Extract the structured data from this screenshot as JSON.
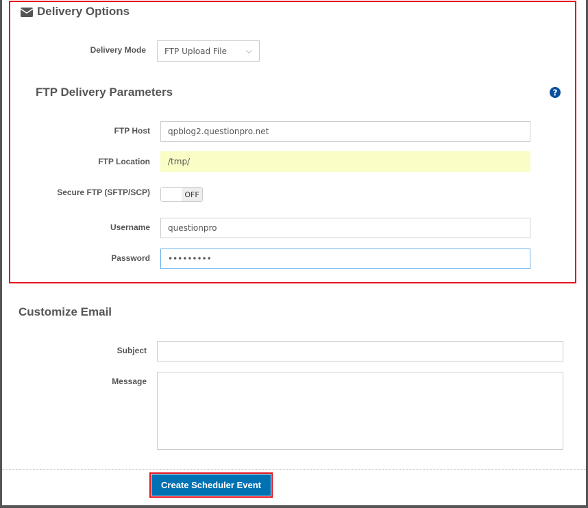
{
  "delivery": {
    "title": "Delivery Options",
    "mode_label": "Delivery Mode",
    "mode_value": "FTP Upload File"
  },
  "ftp": {
    "title": "FTP Delivery Parameters",
    "host_label": "FTP Host",
    "host_value": "qpblog2.questionpro.net",
    "location_label": "FTP Location",
    "location_value": "/tmp/",
    "secure_label": "Secure FTP (SFTP/SCP)",
    "secure_state": "OFF",
    "username_label": "Username",
    "username_value": "questionpro",
    "password_label": "Password",
    "password_value": "•••••••••"
  },
  "email": {
    "title": "Customize Email",
    "subject_label": "Subject",
    "subject_value": "",
    "message_label": "Message",
    "message_value": ""
  },
  "actions": {
    "create_label": "Create Scheduler Event"
  },
  "colors": {
    "highlight": "#e3131e",
    "primary": "#0071b3",
    "help": "#0b4f9c"
  }
}
